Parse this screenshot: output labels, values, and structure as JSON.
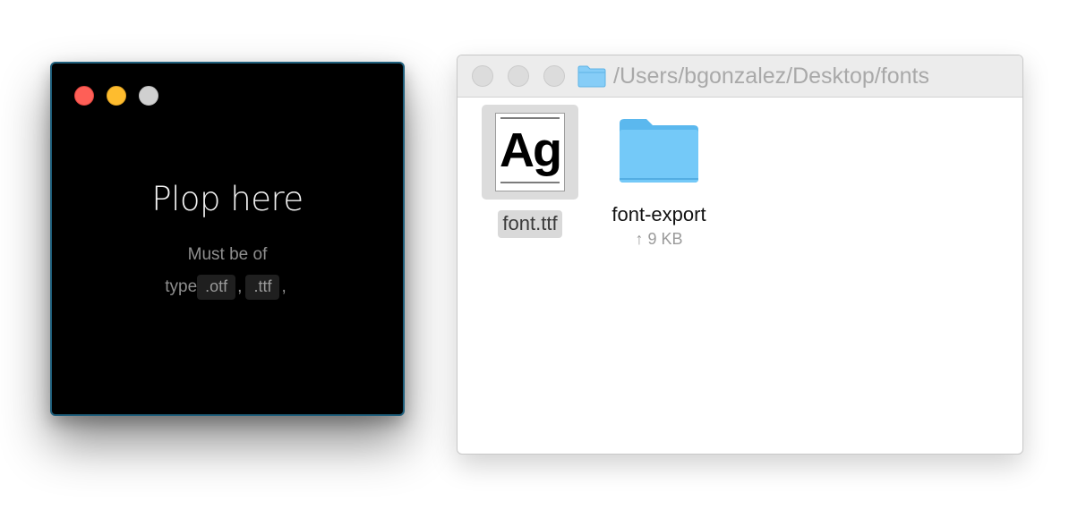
{
  "drop_window": {
    "title": "Plop here",
    "subtitle_line1": "Must be of",
    "subtitle_type": "type",
    "file_types": [
      ".otf",
      ".ttf"
    ],
    "separator": ",",
    "trailing_separator": ",",
    "window_controls": [
      "close",
      "minimize",
      "zoom"
    ]
  },
  "finder": {
    "path": "/Users/bgonzalez/Desktop/fonts",
    "folder_icon": "folder-icon",
    "items": [
      {
        "name": "font.ttf",
        "icon": "font-file-icon",
        "icon_text": "Ag",
        "selected": true
      },
      {
        "name": "font-export",
        "icon": "folder-icon",
        "size": "↑ 9 KB",
        "selected": false
      }
    ]
  },
  "colors": {
    "close": "#fe5f57",
    "minimize": "#febc2e",
    "zoom_inactive": "#d0d0d0",
    "folder_blue": "#6cc4f6",
    "drop_window_border": "#1f5f7c"
  }
}
